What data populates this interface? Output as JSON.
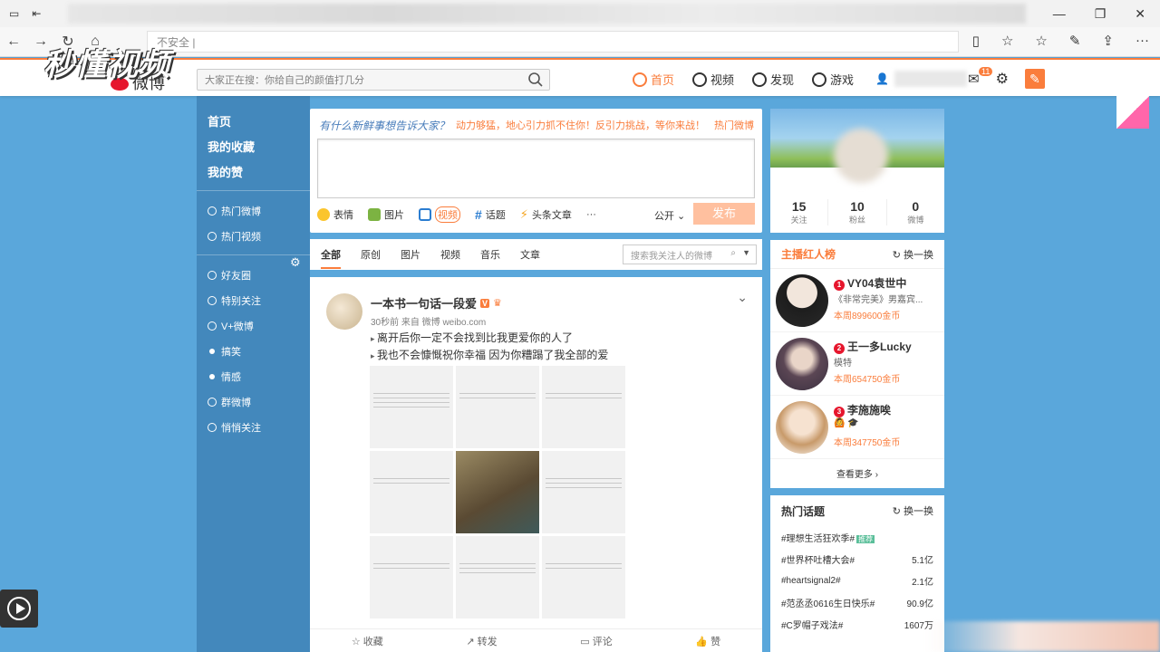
{
  "browser": {
    "address": "不安全 | ",
    "watermark": "秒懂视频"
  },
  "weibo": {
    "logo": "微博",
    "search_placeholder": "大家正在搜：你给自己的颜值打几分",
    "nav": [
      "首页",
      "视频",
      "发现",
      "游戏"
    ],
    "msg_badge": "11"
  },
  "left_nav": {
    "main": [
      "首页",
      "我的收藏",
      "我的赞"
    ],
    "group1": [
      "热门微博",
      "热门视频"
    ],
    "group2": [
      "好友圈",
      "特别关注",
      "V+微博",
      "搞笑",
      "情感",
      "群微博",
      "悄悄关注"
    ]
  },
  "publisher": {
    "slogan": "有什么新鲜事想告诉大家？",
    "hot_text": "动力够猛，地心引力抓不住你！反引力挑战，等你来战！",
    "hot_link": "热门微博",
    "tools": [
      "表情",
      "图片",
      "视频",
      "话题",
      "头条文章",
      "···"
    ],
    "scope": "公开 ⌄",
    "send": "发布"
  },
  "tabs": {
    "items": [
      "全部",
      "原创",
      "图片",
      "视频",
      "音乐",
      "文章"
    ],
    "search_placeholder": "搜索我关注人的微博"
  },
  "feed": {
    "author": "一本书一句话一段爱",
    "meta": "30秒前 来自 微博 weibo.com",
    "lines": [
      "离开后你一定不会找到比我更爱你的人了",
      "我也不会慷慨祝你幸福 因为你糟蹋了我全部的爱"
    ],
    "actions": [
      "收藏",
      "转发",
      "评论",
      "赞"
    ]
  },
  "profile": {
    "stats": [
      {
        "num": "15",
        "label": "关注"
      },
      {
        "num": "10",
        "label": "粉丝"
      },
      {
        "num": "0",
        "label": "微博"
      }
    ]
  },
  "rank": {
    "title": "主播红人榜",
    "switch": "换一换",
    "items": [
      {
        "no": "1",
        "name": "VY04袁世中",
        "desc": "《非常完美》男嘉宾...",
        "gold": "本周899600金币",
        "color": "#e9e4de"
      },
      {
        "no": "2",
        "name": "王一多Lucky",
        "desc": "模特",
        "gold": "本周654750金币",
        "color": "#6b5a66"
      },
      {
        "no": "3",
        "name": "李施施唉",
        "desc": "🙆 🎓",
        "gold": "本周347750金币",
        "color": "#d9b48d"
      }
    ],
    "more": "查看更多 ›"
  },
  "topics": {
    "title": "热门话题",
    "switch": "换一换",
    "items": [
      {
        "name": "#理想生活狂欢季#",
        "count": "",
        "tag": "推荐"
      },
      {
        "name": "#世界杯吐槽大会#",
        "count": "5.1亿",
        "tag": ""
      },
      {
        "name": "#heartsignal2#",
        "count": "2.1亿",
        "tag": ""
      },
      {
        "name": "#范丞丞0616生日快乐#",
        "count": "90.9亿",
        "tag": ""
      },
      {
        "name": "#C罗帽子戏法#",
        "count": "1607万",
        "tag": ""
      }
    ]
  }
}
